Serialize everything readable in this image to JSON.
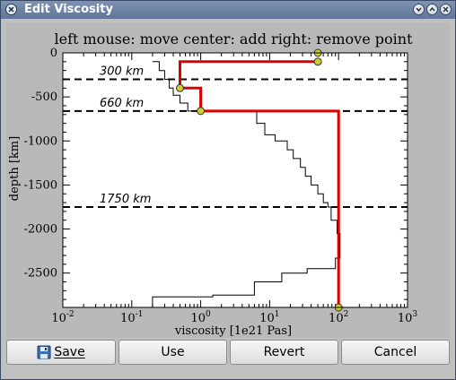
{
  "window": {
    "title": "Edit Viscosity",
    "controls": [
      "window-menu-icon",
      "minimize-icon",
      "restore-icon",
      "close-icon"
    ]
  },
  "plot": {
    "title": "left mouse: move center: add right: remove point",
    "xlabel": "viscosity [1e21 Pas]",
    "ylabel": "depth [km]",
    "x_ticks": [
      {
        "base": "10",
        "exp": "-2"
      },
      {
        "base": "10",
        "exp": "-1"
      },
      {
        "base": "10",
        "exp": "0"
      },
      {
        "base": "10",
        "exp": "1"
      },
      {
        "base": "10",
        "exp": "2"
      },
      {
        "base": "10",
        "exp": "3"
      }
    ],
    "y_ticks": [
      "0",
      "-500",
      "-1000",
      "-1500",
      "-2000",
      "-2500"
    ],
    "annotations": [
      "300 km",
      "660 km",
      "1750 km"
    ]
  },
  "chart_data": {
    "type": "line",
    "xscale": "log",
    "xlim": [
      0.01,
      1000
    ],
    "ylim": [
      -2890,
      0
    ],
    "grid": false,
    "reference_lines": [
      {
        "depth": -300,
        "label": "300 km",
        "style": "dashed"
      },
      {
        "depth": -660,
        "label": "660 km",
        "style": "dashed"
      },
      {
        "depth": -1750,
        "label": "1750 km",
        "style": "dashed"
      }
    ],
    "reference_profile": {
      "color": "#000000",
      "points": [
        [
          0.2,
          -100
        ],
        [
          0.25,
          -100
        ],
        [
          0.25,
          -200
        ],
        [
          0.3,
          -200
        ],
        [
          0.3,
          -300
        ],
        [
          0.35,
          -300
        ],
        [
          0.35,
          -400
        ],
        [
          0.4,
          -400
        ],
        [
          0.4,
          -480
        ],
        [
          0.5,
          -480
        ],
        [
          0.5,
          -570
        ],
        [
          0.65,
          -570
        ],
        [
          0.65,
          -660
        ],
        [
          6.5,
          -660
        ],
        [
          6.5,
          -800
        ],
        [
          8.5,
          -800
        ],
        [
          8.5,
          -930
        ],
        [
          12,
          -930
        ],
        [
          12,
          -1000
        ],
        [
          18,
          -1000
        ],
        [
          18,
          -1100
        ],
        [
          22,
          -1100
        ],
        [
          22,
          -1200
        ],
        [
          28,
          -1200
        ],
        [
          28,
          -1300
        ],
        [
          33,
          -1300
        ],
        [
          33,
          -1400
        ],
        [
          40,
          -1400
        ],
        [
          40,
          -1500
        ],
        [
          50,
          -1500
        ],
        [
          50,
          -1600
        ],
        [
          60,
          -1600
        ],
        [
          60,
          -1700
        ],
        [
          70,
          -1700
        ],
        [
          70,
          -1750
        ],
        [
          78,
          -1750
        ],
        [
          78,
          -1900
        ],
        [
          95,
          -1900
        ],
        [
          95,
          -2050
        ],
        [
          105,
          -2050
        ],
        [
          105,
          -2330
        ],
        [
          90,
          -2330
        ],
        [
          90,
          -2450
        ],
        [
          35,
          -2450
        ],
        [
          35,
          -2500
        ],
        [
          15,
          -2500
        ],
        [
          15,
          -2600
        ],
        [
          6,
          -2600
        ],
        [
          6,
          -2750
        ],
        [
          1.5,
          -2750
        ],
        [
          1.5,
          -2770
        ],
        [
          0.2,
          -2770
        ],
        [
          0.2,
          -2890
        ]
      ]
    },
    "edited_profile": {
      "color": "#dd0000",
      "points": [
        [
          50,
          -100
        ],
        [
          0.5,
          -100
        ],
        [
          0.5,
          -400
        ],
        [
          1,
          -400
        ],
        [
          1,
          -660
        ],
        [
          100,
          -660
        ],
        [
          100,
          -2890
        ]
      ],
      "control_points": [
        [
          50,
          0
        ],
        [
          50,
          -100
        ],
        [
          0.5,
          -400
        ],
        [
          1,
          -660
        ],
        [
          100,
          -2890
        ]
      ],
      "control_point_color": "#cccc33"
    }
  },
  "buttons": {
    "save_label": "Save",
    "use_label": "Use",
    "revert_label": "Revert",
    "cancel_label": "Cancel"
  }
}
